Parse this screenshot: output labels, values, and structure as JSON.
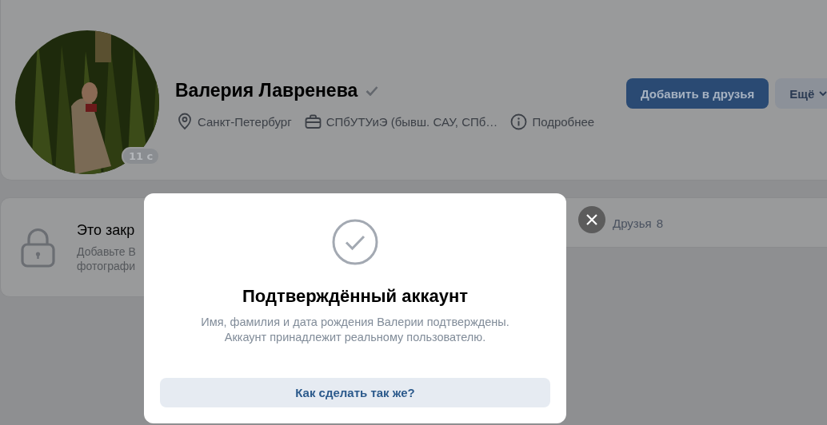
{
  "profile": {
    "name": "Валерия Лавренева",
    "verified": true,
    "online_badge": "11 с",
    "details": [
      {
        "kind": "location",
        "text": "Санкт-Петербург"
      },
      {
        "kind": "work",
        "text": "СПбУТУиЭ (бывш. САУ, СПб…"
      },
      {
        "kind": "info",
        "text": "Подробнее"
      }
    ],
    "buttons": [
      {
        "kind": "primary",
        "label": "Добавить в друзья"
      },
      {
        "kind": "menu",
        "label": "Ещё"
      }
    ]
  },
  "closed_notice": {
    "title": "Это закр",
    "lines": [
      "Добавьте В",
      "фотографи"
    ]
  },
  "friends": {
    "label": "Друзья",
    "count": "8"
  },
  "modal": {
    "title": "Подтверждённый аккаунт",
    "lines": [
      "Имя, фамилия и дата рождения Валерии подтверждены.",
      "Аккаунт принадлежит реальному пользователю."
    ],
    "button": "Как сделать так же?"
  }
}
